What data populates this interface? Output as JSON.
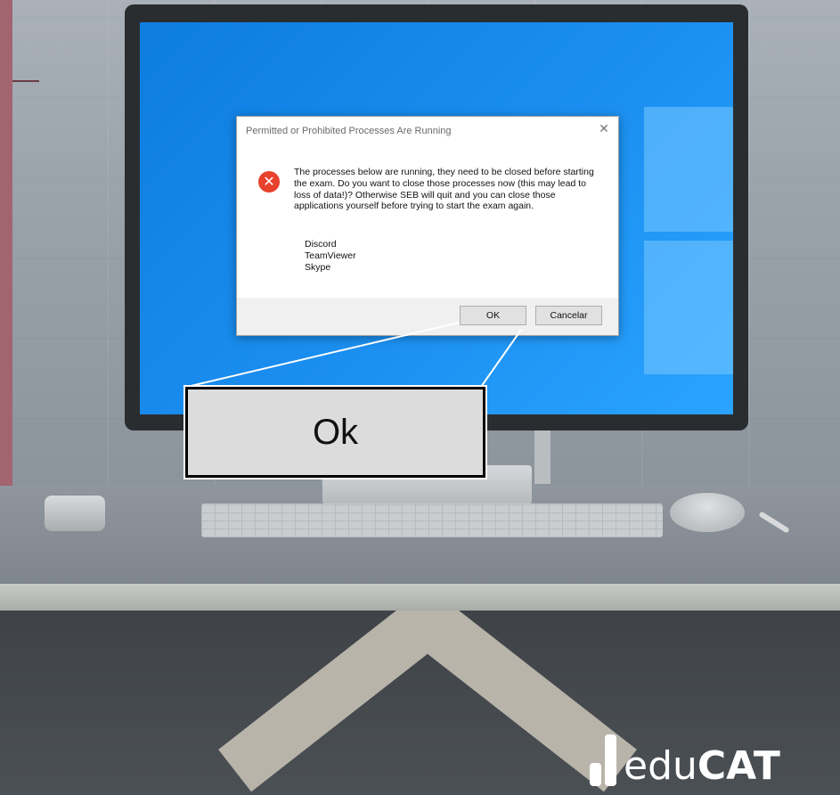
{
  "dialog": {
    "title": "Permitted or Prohibited Processes Are Running",
    "close_glyph": "✕",
    "message": "The processes below are running, they need to be closed before starting the exam. Do you want to close those processes now (this may lead to loss of data!)? Otherwise SEB will quit and you can close those applications yourself before trying to start the exam again.",
    "processes": [
      "Discord",
      "TeamViewer",
      "Skype"
    ],
    "ok_label": "OK",
    "cancel_label": "Cancelar",
    "icon": "error-icon",
    "icon_glyph": "✕"
  },
  "callout": {
    "label": "Ok"
  },
  "logo": {
    "text_light": "edu",
    "text_bold": "CAT"
  },
  "colors": {
    "desktop_blue": "#1b8ff0",
    "error_red": "#e8412c",
    "accent_side": "#a2656f"
  }
}
